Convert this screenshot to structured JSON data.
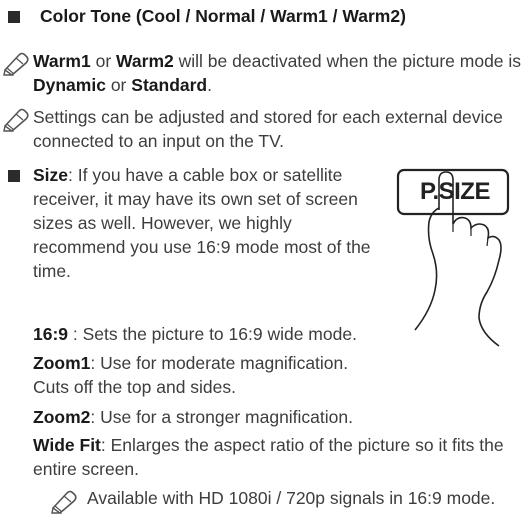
{
  "color_tone": {
    "heading": "Color Tone (Cool / Normal / Warm1 / Warm2)"
  },
  "note_warm": {
    "w1": "Warm1",
    "or1": "or",
    "w2": "Warm2",
    "mid": "will be deactivated when the picture mode is",
    "dyn": "Dynamic",
    "or2": "or",
    "std": "Standard",
    "end": "."
  },
  "note_settings": {
    "text": "Settings can be adjusted and stored for each external device connected to an input on the TV."
  },
  "size": {
    "label": "Size",
    "text": ": If you have a cable box or satellite receiver, it may have its own set of screen sizes as well. However, we highly recommend you use 16:9 mode most of the time.",
    "button_label": "P.SIZE"
  },
  "modes": [
    {
      "name": "16:9",
      "desc": " : Sets the picture to 16:9 wide mode."
    },
    {
      "name": "Zoom1",
      "desc": ": Use for moderate magnification. Cuts off the top and sides."
    },
    {
      "name": "Zoom2",
      "desc": ": Use for a stronger magnification."
    },
    {
      "name": "Wide Fit",
      "desc": ": Enlarges the aspect ratio of the picture so it fits the entire screen."
    }
  ],
  "note_hd": {
    "text": "Available with HD 1080i / 720p signals in 16:9 mode."
  }
}
